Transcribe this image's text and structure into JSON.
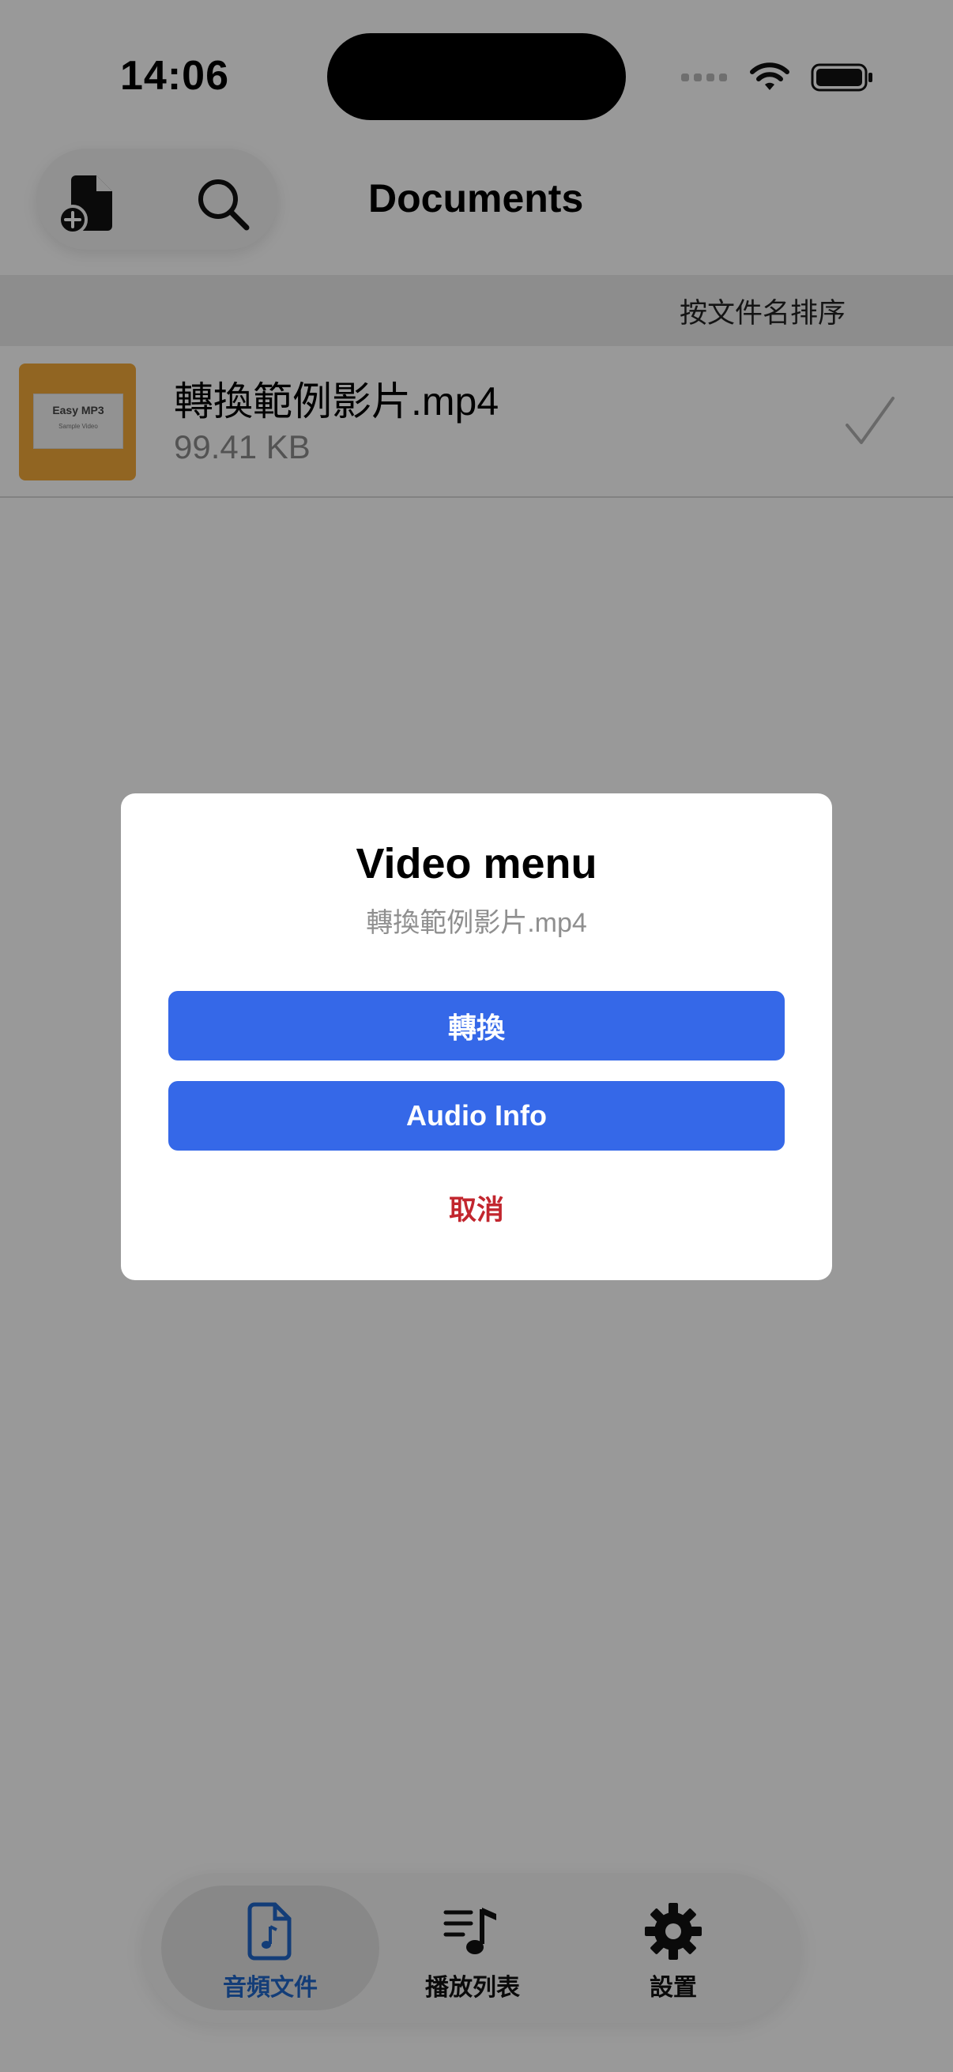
{
  "status_bar": {
    "time": "14:06"
  },
  "toolbar": {
    "add_file_icon": "add-document-icon",
    "search_icon": "magnifier-icon",
    "title": "Documents"
  },
  "sort": {
    "label": "按文件名排序"
  },
  "files": [
    {
      "name": "轉換範例影片.mp4",
      "size": "99.41 KB",
      "thumbnail_title": "Easy MP3",
      "thumbnail_sub": "Sample Video",
      "selected": true
    }
  ],
  "dialog": {
    "title": "Video menu",
    "subtitle": "轉換範例影片.mp4",
    "convert_label": "轉換",
    "audio_info_label": "Audio Info",
    "cancel_label": "取消"
  },
  "tabs": [
    {
      "label": "音頻文件",
      "icon": "audio-file-icon",
      "active": true
    },
    {
      "label": "播放列表",
      "icon": "playlist-icon",
      "active": false
    },
    {
      "label": "設置",
      "icon": "gear-icon",
      "active": false
    }
  ],
  "colors": {
    "accent_blue": "#3568e8",
    "active_tab_blue": "#2167c9",
    "cancel_red": "#c2262e",
    "thumbnail_orange": "#f2a83a"
  }
}
